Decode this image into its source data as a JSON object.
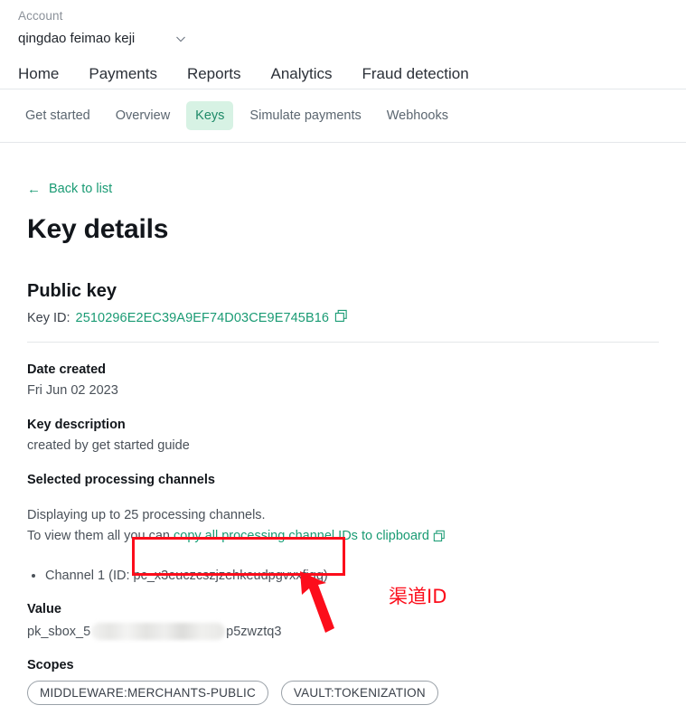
{
  "account": {
    "label": "Account",
    "name": "qingdao feimao keji"
  },
  "primary_nav": [
    {
      "label": "Home"
    },
    {
      "label": "Payments"
    },
    {
      "label": "Reports"
    },
    {
      "label": "Analytics"
    },
    {
      "label": "Fraud detection"
    }
  ],
  "tabs": [
    {
      "label": "Get started",
      "active": false
    },
    {
      "label": "Overview",
      "active": false
    },
    {
      "label": "Keys",
      "active": true
    },
    {
      "label": "Simulate payments",
      "active": false
    },
    {
      "label": "Webhooks",
      "active": false
    }
  ],
  "back_link": {
    "label": "Back to list",
    "arrow": "←"
  },
  "page_title": "Key details",
  "public_key": {
    "section_title": "Public key",
    "key_id_label": "Key ID:",
    "key_id_value": "2510296E2EC39A9EF74D03CE9E745B16"
  },
  "date_created": {
    "label": "Date created",
    "value": "Fri Jun 02 2023"
  },
  "key_description": {
    "label": "Key description",
    "value": "created by get started guide"
  },
  "processing_channels": {
    "label": "Selected processing channels",
    "note_line1": "Displaying up to 25 processing channels.",
    "note_line2_prefix": "To view them all you can ",
    "note_line2_link": "copy all processing channel IDs to clipboard",
    "items": [
      {
        "text": "Channel 1 (ID: pc_x3euczcszjzehkeudpgvxxfiqq)"
      }
    ]
  },
  "value": {
    "label": "Value",
    "prefix": "pk_sbox_5",
    "suffix": "p5zwztq3"
  },
  "scopes": {
    "label": "Scopes",
    "badges": [
      {
        "text": "MIDDLEWARE:MERCHANTS-PUBLIC"
      },
      {
        "text": "VAULT:TOKENIZATION"
      }
    ]
  },
  "annotations": {
    "channel_id_label": "渠道ID",
    "accent_color": "#fc0d1b"
  },
  "colors": {
    "brand_green": "#1a9b74",
    "active_tab_bg": "#d7f2e4",
    "active_tab_text": "#1e8a68",
    "divider": "#e4e7ea",
    "annotation_red": "#fc0d1b"
  }
}
